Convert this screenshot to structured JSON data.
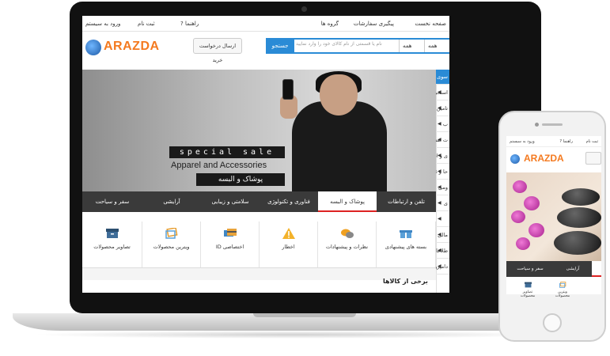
{
  "colors": {
    "accent": "#2a8bd6",
    "logo": "#f47a20",
    "tab_bar": "#3a3a3a",
    "active_tab_underline": "#dd2222"
  },
  "topbar": {
    "home": "صفحه نخست",
    "track": "پیگیری سفارشات",
    "groups": "گروه ها",
    "help": "? راهنما",
    "register": "ثبت نام",
    "login": "ورود به سیستم"
  },
  "header": {
    "logo": "ARAZDA",
    "request_button": "ارسال درخواست خرید",
    "search_button": "جستجو",
    "search_placeholder": "نام یا قسمتی از نام کالای خود را وارد نمایید",
    "select1": "همه",
    "select2": "همه"
  },
  "hero": {
    "special": "special sale",
    "apparel": "Apparel and Accessories",
    "persian": "پوشاک و البسه"
  },
  "sidebar": {
    "items": [
      {
        "label": "سوی اصلی"
      },
      {
        "label": "استخراج معدن"
      },
      {
        "label": "تامین برق، گاز، بخار و تهویه هوا"
      },
      {
        "label": "ب"
      },
      {
        "label": "ت صنعتی"
      },
      {
        "label": "ی و انبارداری"
      },
      {
        "label": "حا و غذا"
      },
      {
        "label": "ومی"
      },
      {
        "label": "ی"
      },
      {
        "label": ""
      },
      {
        "label": "مالی و بیمه"
      },
      {
        "label": "طلاعات و ارتباطات"
      },
      {
        "label": "دامپروری"
      },
      {
        "label": ""
      }
    ]
  },
  "tabs": [
    {
      "label": "تلفن و ارتباطات"
    },
    {
      "label": "پوشاک و البسه"
    },
    {
      "label": "فناوری و تکنولوژی"
    },
    {
      "label": "سلامتی و زیبایی"
    },
    {
      "label": "آرایشی"
    },
    {
      "label": "سفر و سیاحت"
    }
  ],
  "features": [
    {
      "label": "بسته های پیشنهادی",
      "icon": "gift-icon"
    },
    {
      "label": "نظرات و پیشنهادات",
      "icon": "chat-icon"
    },
    {
      "label": "اخطار",
      "icon": "warning-icon"
    },
    {
      "label": "ID اختصاصی",
      "icon": "id-card-icon"
    },
    {
      "label": "ویترین محصولات",
      "icon": "showcase-icon"
    },
    {
      "label": "تصاویر محصولات",
      "icon": "archive-icon"
    }
  ],
  "section_title": "برخی از کالاها",
  "phone": {
    "register": "ثبت نام",
    "login": "ورود به سیستم",
    "help": "? راهنما",
    "logo": "ARAZDA",
    "tabs": [
      {
        "label": "سفر و سیاحت"
      },
      {
        "label": "آرایشی"
      }
    ],
    "features": [
      {
        "label": "تصاویر محصولات"
      },
      {
        "label": "ویترین محصولات"
      }
    ]
  }
}
